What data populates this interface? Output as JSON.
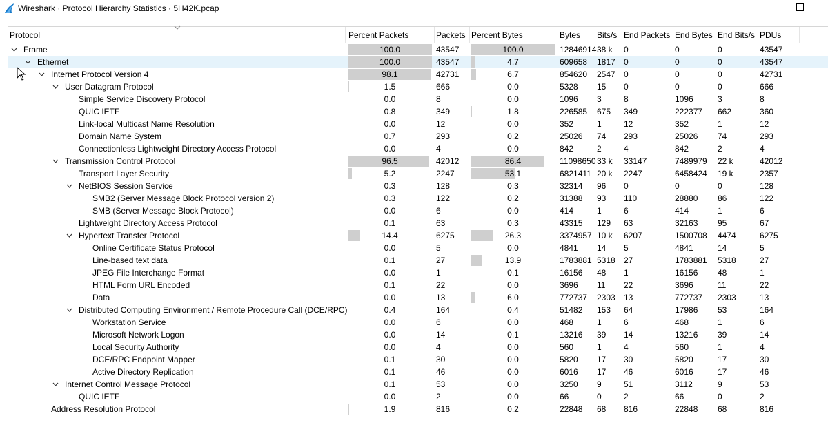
{
  "window": {
    "title": "Wireshark · Protocol Hierarchy Statistics · 5H42K.pcap"
  },
  "columns": [
    "Protocol",
    "Percent Packets",
    "Packets",
    "Percent Bytes",
    "Bytes",
    "Bits/s",
    "End Packets",
    "End Bytes",
    "End Bits/s",
    "PDUs"
  ],
  "rows": [
    {
      "level": 0,
      "expander": "open",
      "name": "Frame",
      "pct_packets": "100.0",
      "packets": "43547",
      "pct_bytes": "100.0",
      "bytes": "12846914",
      "bits": "38 k",
      "end_packets": "0",
      "end_bytes": "0",
      "end_bits": "0",
      "pdus": "43547",
      "pp": 100.0,
      "pb": 100.0
    },
    {
      "level": 1,
      "expander": "open",
      "name": "Ethernet",
      "pct_packets": "100.0",
      "packets": "43547",
      "pct_bytes": "4.7",
      "bytes": "609658",
      "bits": "1817",
      "end_packets": "0",
      "end_bytes": "0",
      "end_bits": "0",
      "pdus": "43547",
      "pp": 100.0,
      "pb": 4.7,
      "selected": true
    },
    {
      "level": 2,
      "expander": "open",
      "name": "Internet Protocol Version 4",
      "pct_packets": "98.1",
      "packets": "42731",
      "pct_bytes": "6.7",
      "bytes": "854620",
      "bits": "2547",
      "end_packets": "0",
      "end_bytes": "0",
      "end_bits": "0",
      "pdus": "42731",
      "pp": 98.1,
      "pb": 6.7
    },
    {
      "level": 3,
      "expander": "open",
      "name": "User Datagram Protocol",
      "pct_packets": "1.5",
      "packets": "666",
      "pct_bytes": "0.0",
      "bytes": "5328",
      "bits": "15",
      "end_packets": "0",
      "end_bytes": "0",
      "end_bits": "0",
      "pdus": "666",
      "pp": 1.5,
      "pb": 0.0
    },
    {
      "level": 4,
      "expander": "none",
      "name": "Simple Service Discovery Protocol",
      "pct_packets": "0.0",
      "packets": "8",
      "pct_bytes": "0.0",
      "bytes": "1096",
      "bits": "3",
      "end_packets": "8",
      "end_bytes": "1096",
      "end_bits": "3",
      "pdus": "8",
      "pp": 0.0,
      "pb": 0.0
    },
    {
      "level": 4,
      "expander": "none",
      "name": "QUIC IETF",
      "pct_packets": "0.8",
      "packets": "349",
      "pct_bytes": "1.8",
      "bytes": "226585",
      "bits": "675",
      "end_packets": "349",
      "end_bytes": "222377",
      "end_bits": "662",
      "pdus": "360",
      "pp": 0.8,
      "pb": 1.8
    },
    {
      "level": 4,
      "expander": "none",
      "name": "Link-local Multicast Name Resolution",
      "pct_packets": "0.0",
      "packets": "12",
      "pct_bytes": "0.0",
      "bytes": "352",
      "bits": "1",
      "end_packets": "12",
      "end_bytes": "352",
      "end_bits": "1",
      "pdus": "12",
      "pp": 0.0,
      "pb": 0.0
    },
    {
      "level": 4,
      "expander": "none",
      "name": "Domain Name System",
      "pct_packets": "0.7",
      "packets": "293",
      "pct_bytes": "0.2",
      "bytes": "25026",
      "bits": "74",
      "end_packets": "293",
      "end_bytes": "25026",
      "end_bits": "74",
      "pdus": "293",
      "pp": 0.7,
      "pb": 0.2
    },
    {
      "level": 4,
      "expander": "none",
      "name": "Connectionless Lightweight Directory Access Protocol",
      "pct_packets": "0.0",
      "packets": "4",
      "pct_bytes": "0.0",
      "bytes": "842",
      "bits": "2",
      "end_packets": "4",
      "end_bytes": "842",
      "end_bits": "2",
      "pdus": "4",
      "pp": 0.0,
      "pb": 0.0
    },
    {
      "level": 3,
      "expander": "open",
      "name": "Transmission Control Protocol",
      "pct_packets": "96.5",
      "packets": "42012",
      "pct_bytes": "86.4",
      "bytes": "11098650",
      "bits": "33 k",
      "end_packets": "33147",
      "end_bytes": "7489979",
      "end_bits": "22 k",
      "pdus": "42012",
      "pp": 96.5,
      "pb": 86.4
    },
    {
      "level": 4,
      "expander": "none",
      "name": "Transport Layer Security",
      "pct_packets": "5.2",
      "packets": "2247",
      "pct_bytes": "53.1",
      "bytes": "6821411",
      "bits": "20 k",
      "end_packets": "2247",
      "end_bytes": "6458424",
      "end_bits": "19 k",
      "pdus": "2357",
      "pp": 5.2,
      "pb": 53.1
    },
    {
      "level": 4,
      "expander": "open",
      "name": "NetBIOS Session Service",
      "pct_packets": "0.3",
      "packets": "128",
      "pct_bytes": "0.3",
      "bytes": "32314",
      "bits": "96",
      "end_packets": "0",
      "end_bytes": "0",
      "end_bits": "0",
      "pdus": "128",
      "pp": 0.3,
      "pb": 0.3
    },
    {
      "level": 5,
      "expander": "none",
      "name": "SMB2 (Server Message Block Protocol version 2)",
      "pct_packets": "0.3",
      "packets": "122",
      "pct_bytes": "0.2",
      "bytes": "31388",
      "bits": "93",
      "end_packets": "110",
      "end_bytes": "28880",
      "end_bits": "86",
      "pdus": "122",
      "pp": 0.3,
      "pb": 0.2
    },
    {
      "level": 5,
      "expander": "none",
      "name": "SMB (Server Message Block Protocol)",
      "pct_packets": "0.0",
      "packets": "6",
      "pct_bytes": "0.0",
      "bytes": "414",
      "bits": "1",
      "end_packets": "6",
      "end_bytes": "414",
      "end_bits": "1",
      "pdus": "6",
      "pp": 0.0,
      "pb": 0.0
    },
    {
      "level": 4,
      "expander": "none",
      "name": "Lightweight Directory Access Protocol",
      "pct_packets": "0.1",
      "packets": "63",
      "pct_bytes": "0.3",
      "bytes": "43315",
      "bits": "129",
      "end_packets": "63",
      "end_bytes": "32163",
      "end_bits": "95",
      "pdus": "67",
      "pp": 0.1,
      "pb": 0.3
    },
    {
      "level": 4,
      "expander": "open",
      "name": "Hypertext Transfer Protocol",
      "pct_packets": "14.4",
      "packets": "6275",
      "pct_bytes": "26.3",
      "bytes": "3374957",
      "bits": "10 k",
      "end_packets": "6207",
      "end_bytes": "1500708",
      "end_bits": "4474",
      "pdus": "6275",
      "pp": 14.4,
      "pb": 26.3
    },
    {
      "level": 5,
      "expander": "none",
      "name": "Online Certificate Status Protocol",
      "pct_packets": "0.0",
      "packets": "5",
      "pct_bytes": "0.0",
      "bytes": "4841",
      "bits": "14",
      "end_packets": "5",
      "end_bytes": "4841",
      "end_bits": "14",
      "pdus": "5",
      "pp": 0.0,
      "pb": 0.0
    },
    {
      "level": 5,
      "expander": "none",
      "name": "Line-based text data",
      "pct_packets": "0.1",
      "packets": "27",
      "pct_bytes": "13.9",
      "bytes": "1783881",
      "bits": "5318",
      "end_packets": "27",
      "end_bytes": "1783881",
      "end_bits": "5318",
      "pdus": "27",
      "pp": 0.1,
      "pb": 13.9
    },
    {
      "level": 5,
      "expander": "none",
      "name": "JPEG File Interchange Format",
      "pct_packets": "0.0",
      "packets": "1",
      "pct_bytes": "0.1",
      "bytes": "16156",
      "bits": "48",
      "end_packets": "1",
      "end_bytes": "16156",
      "end_bits": "48",
      "pdus": "1",
      "pp": 0.0,
      "pb": 0.1
    },
    {
      "level": 5,
      "expander": "none",
      "name": "HTML Form URL Encoded",
      "pct_packets": "0.1",
      "packets": "22",
      "pct_bytes": "0.0",
      "bytes": "3696",
      "bits": "11",
      "end_packets": "22",
      "end_bytes": "3696",
      "end_bits": "11",
      "pdus": "22",
      "pp": 0.1,
      "pb": 0.0
    },
    {
      "level": 5,
      "expander": "none",
      "name": "Data",
      "pct_packets": "0.0",
      "packets": "13",
      "pct_bytes": "6.0",
      "bytes": "772737",
      "bits": "2303",
      "end_packets": "13",
      "end_bytes": "772737",
      "end_bits": "2303",
      "pdus": "13",
      "pp": 0.0,
      "pb": 6.0
    },
    {
      "level": 4,
      "expander": "open",
      "name": "Distributed Computing Environment / Remote Procedure Call (DCE/RPC)",
      "pct_packets": "0.4",
      "packets": "164",
      "pct_bytes": "0.4",
      "bytes": "51482",
      "bits": "153",
      "end_packets": "64",
      "end_bytes": "17986",
      "end_bits": "53",
      "pdus": "164",
      "pp": 0.4,
      "pb": 0.4
    },
    {
      "level": 5,
      "expander": "none",
      "name": "Workstation Service",
      "pct_packets": "0.0",
      "packets": "6",
      "pct_bytes": "0.0",
      "bytes": "468",
      "bits": "1",
      "end_packets": "6",
      "end_bytes": "468",
      "end_bits": "1",
      "pdus": "6",
      "pp": 0.0,
      "pb": 0.0
    },
    {
      "level": 5,
      "expander": "none",
      "name": "Microsoft Network Logon",
      "pct_packets": "0.0",
      "packets": "14",
      "pct_bytes": "0.1",
      "bytes": "13216",
      "bits": "39",
      "end_packets": "14",
      "end_bytes": "13216",
      "end_bits": "39",
      "pdus": "14",
      "pp": 0.0,
      "pb": 0.1
    },
    {
      "level": 5,
      "expander": "none",
      "name": "Local Security Authority",
      "pct_packets": "0.0",
      "packets": "4",
      "pct_bytes": "0.0",
      "bytes": "560",
      "bits": "1",
      "end_packets": "4",
      "end_bytes": "560",
      "end_bits": "1",
      "pdus": "4",
      "pp": 0.0,
      "pb": 0.0
    },
    {
      "level": 5,
      "expander": "none",
      "name": "DCE/RPC Endpoint Mapper",
      "pct_packets": "0.1",
      "packets": "30",
      "pct_bytes": "0.0",
      "bytes": "5820",
      "bits": "17",
      "end_packets": "30",
      "end_bytes": "5820",
      "end_bits": "17",
      "pdus": "30",
      "pp": 0.1,
      "pb": 0.0
    },
    {
      "level": 5,
      "expander": "none",
      "name": "Active Directory Replication",
      "pct_packets": "0.1",
      "packets": "46",
      "pct_bytes": "0.0",
      "bytes": "6016",
      "bits": "17",
      "end_packets": "46",
      "end_bytes": "6016",
      "end_bits": "17",
      "pdus": "46",
      "pp": 0.1,
      "pb": 0.0
    },
    {
      "level": 3,
      "expander": "open",
      "name": "Internet Control Message Protocol",
      "pct_packets": "0.1",
      "packets": "53",
      "pct_bytes": "0.0",
      "bytes": "3250",
      "bits": "9",
      "end_packets": "51",
      "end_bytes": "3112",
      "end_bits": "9",
      "pdus": "53",
      "pp": 0.1,
      "pb": 0.0
    },
    {
      "level": 4,
      "expander": "none",
      "name": "QUIC IETF",
      "pct_packets": "0.0",
      "packets": "2",
      "pct_bytes": "0.0",
      "bytes": "66",
      "bits": "0",
      "end_packets": "2",
      "end_bytes": "66",
      "end_bits": "0",
      "pdus": "2",
      "pp": 0.0,
      "pb": 0.0
    },
    {
      "level": 2,
      "expander": "none",
      "name": "Address Resolution Protocol",
      "pct_packets": "1.9",
      "packets": "816",
      "pct_bytes": "0.2",
      "bytes": "22848",
      "bits": "68",
      "end_packets": "816",
      "end_bytes": "22848",
      "end_bits": "68",
      "pdus": "816",
      "pp": 1.9,
      "pb": 0.2
    }
  ]
}
